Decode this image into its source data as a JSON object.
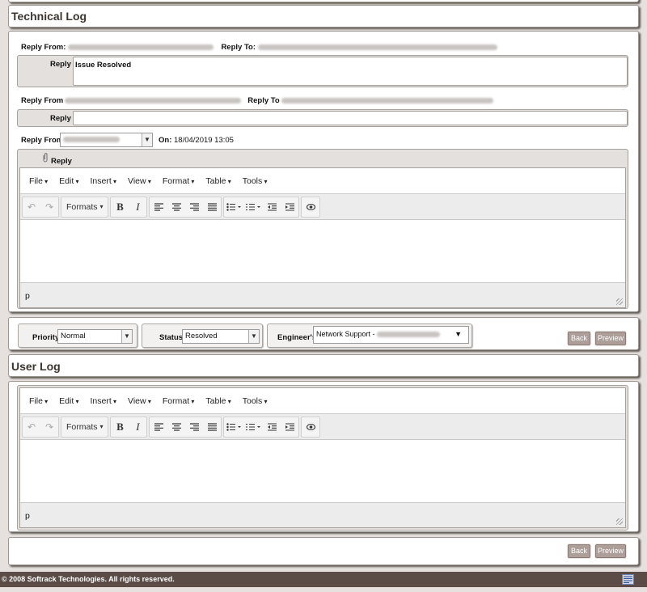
{
  "technical_log": {
    "title": "Technical Log",
    "entry1": {
      "from_label": "Reply From:",
      "to_label": "Reply To:",
      "reply_label": "Reply",
      "reply_text": "Issue Resolved"
    },
    "entry2": {
      "from_label": "Reply From",
      "to_label": "Reply To",
      "reply_label": "Reply",
      "reply_text": ""
    },
    "form": {
      "from_label": "Reply From:",
      "on_label": "On:",
      "on_value": "18/04/2019 13:05",
      "reply_label": "Reply"
    }
  },
  "editor": {
    "menus": [
      "File",
      "Edit",
      "Insert",
      "View",
      "Format",
      "Table",
      "Tools"
    ],
    "formats_label": "Formats",
    "path": "p"
  },
  "fields": {
    "priority_label": "Priority",
    "priority_value": "Normal",
    "status_label": "Status",
    "status_value": "Resolved",
    "engineer_label": "Engineer's",
    "engineer_value": "Network Support -"
  },
  "buttons": {
    "back": "Back",
    "preview": "Preview"
  },
  "user_log": {
    "title": "User Log"
  },
  "footer": {
    "copyright": "© 2008  Softrack Technologies. All rights reserved."
  }
}
